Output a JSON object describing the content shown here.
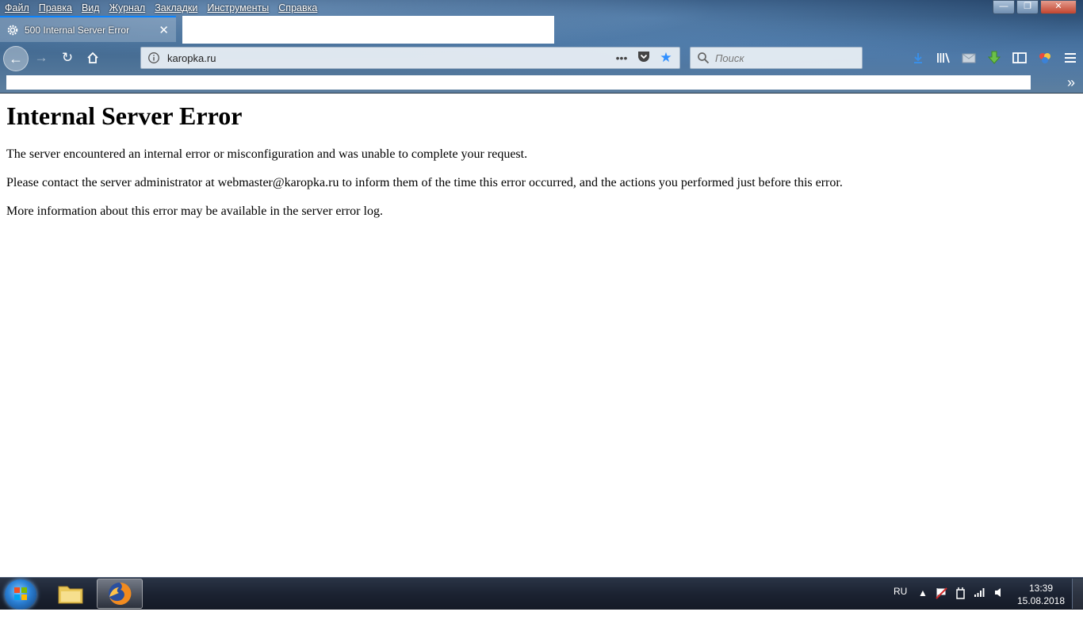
{
  "menubar": {
    "items": [
      "Файл",
      "Правка",
      "Вид",
      "Журнал",
      "Закладки",
      "Инструменты",
      "Справка"
    ]
  },
  "tab": {
    "title": "500 Internal Server Error",
    "icon": "gear-icon"
  },
  "navbar": {
    "url": "karopka.ru",
    "search_placeholder": "Поиск"
  },
  "page": {
    "heading": "Internal Server Error",
    "paragraphs": [
      "The server encountered an internal error or misconfiguration and was unable to complete your request.",
      "Please contact the server administrator at webmaster@karopka.ru to inform them of the time this error occurred, and the actions you performed just before this error.",
      "More information about this error may be available in the server error log."
    ]
  },
  "taskbar": {
    "language": "RU",
    "time": "13:39",
    "date": "15.08.2018"
  },
  "colors": {
    "accent": "#0a84ff",
    "star": "#2f8fff",
    "taskbar": "#1b2231"
  }
}
